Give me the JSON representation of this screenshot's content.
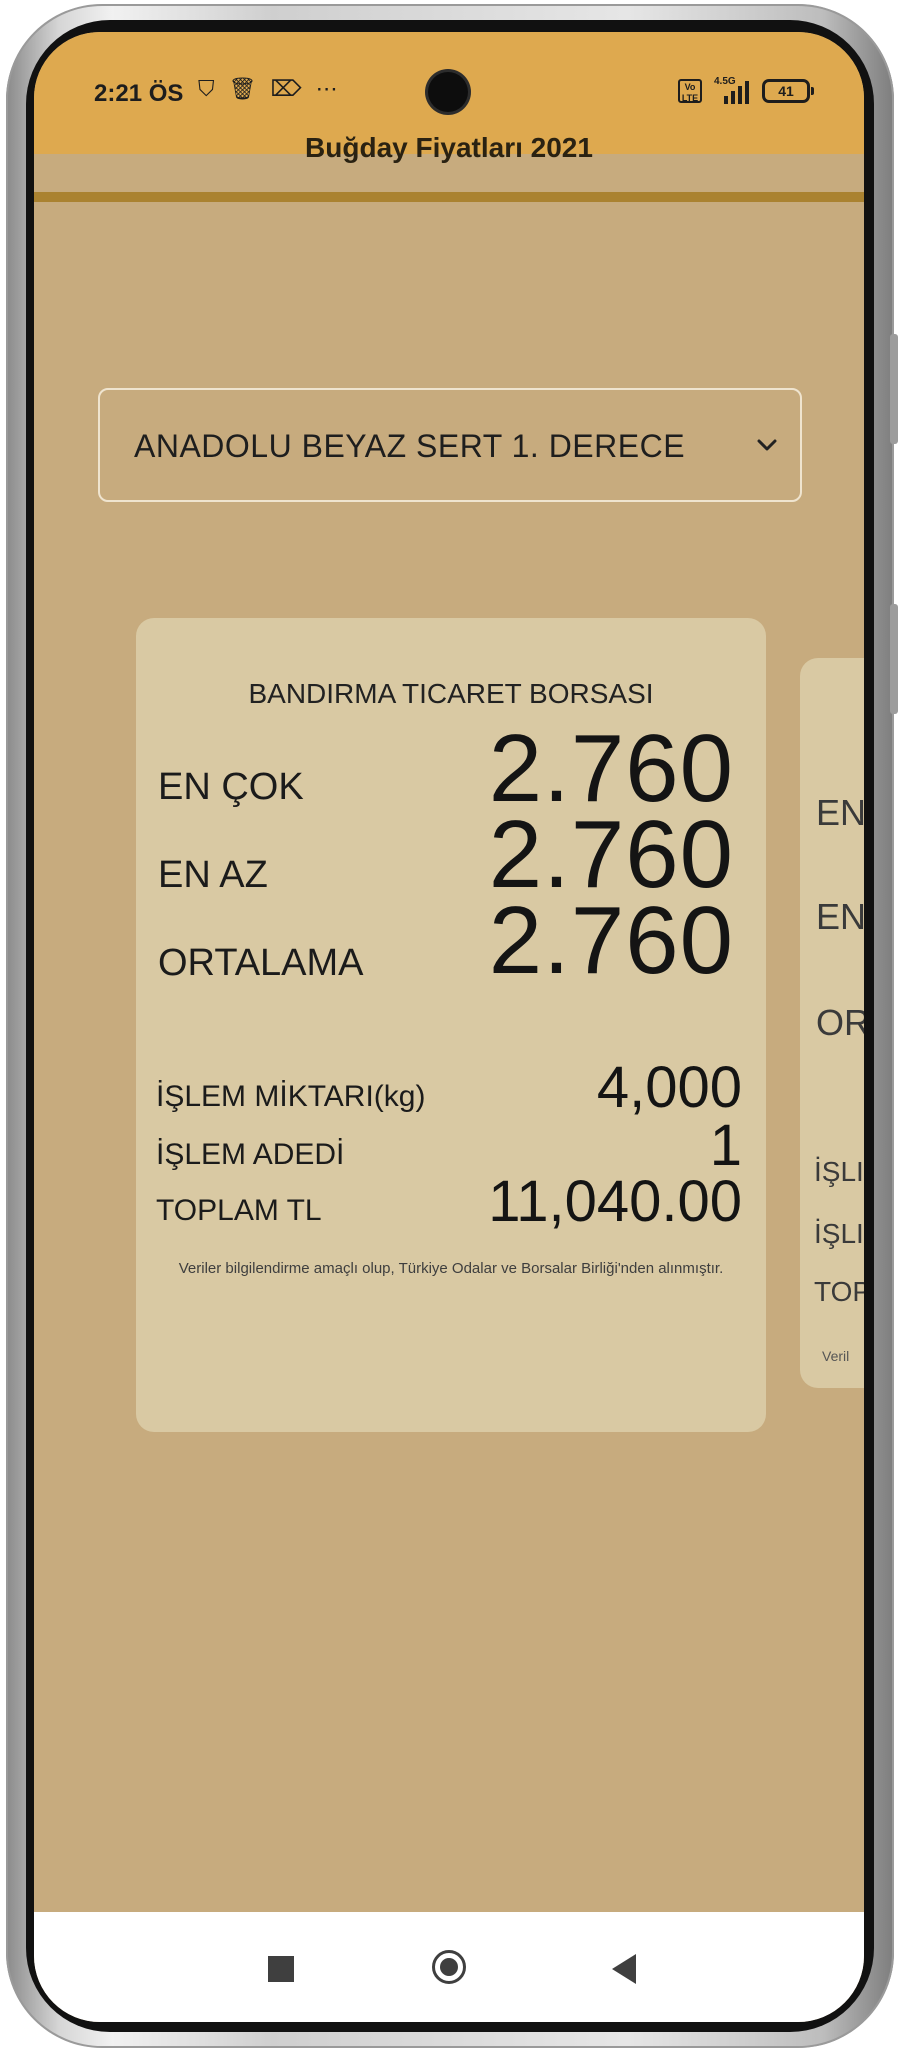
{
  "status_bar": {
    "time": "2:21 ÖS",
    "network": "4.5G",
    "volte": "Vo LTE",
    "battery": "41"
  },
  "app": {
    "title": "Buğday Fiyatları 2021"
  },
  "dropdown": {
    "selected": "ANADOLU BEYAZ SERT 1. DERECE"
  },
  "card": {
    "exchange": "BANDIRMA TICARET BORSASI",
    "max_label": "EN ÇOK",
    "max_value": "2.760",
    "min_label": "EN AZ",
    "min_value": "2.760",
    "avg_label": "ORTALAMA",
    "avg_value": "2.760",
    "quantity_label": "İŞLEM MİKTARI(kg)",
    "quantity_value": "4,000",
    "count_label": "İŞLEM ADEDİ",
    "count_value": "1",
    "total_label": "TOPLAM TL",
    "total_value": "11,040.00",
    "footnote": "Veriler bilgilendirme amaçlı olup, Türkiye Odalar ve Borsalar Birliği'nden alınmıştır."
  },
  "next_card": {
    "l1": "EN",
    "l2": "EN",
    "l3": "OR",
    "s1": "İŞLI",
    "s2": "İŞLI",
    "s3": "TOP",
    "note": "Veril"
  },
  "colors": {
    "status_bar": "#dea94f",
    "background": "#c7ab7e",
    "card": "#d9c9a3"
  }
}
